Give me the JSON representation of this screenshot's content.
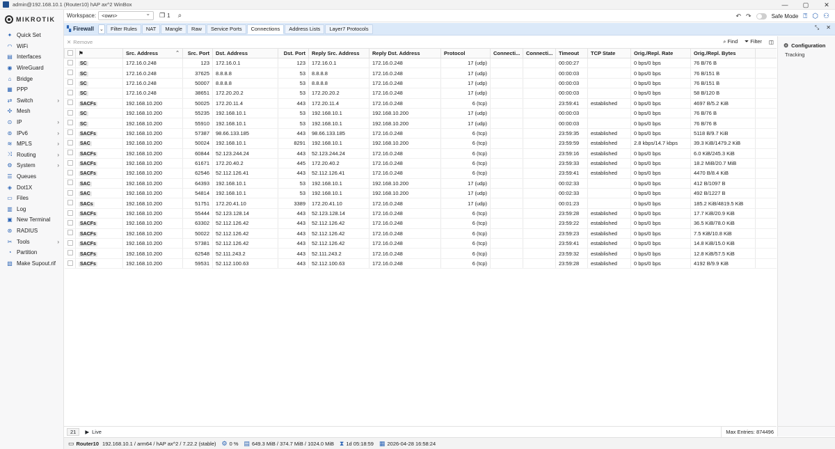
{
  "window": {
    "title": "admin@192.168.10.1 (Router10) hAP ax^2 WinBox",
    "controls": [
      "—",
      "▢",
      "✕"
    ]
  },
  "brand": {
    "logo_text": "MIKROTIK"
  },
  "sidebar": {
    "items": [
      {
        "label": "Quick Set",
        "icon": "magic-wand-icon",
        "glyph": "✦",
        "chevron": ""
      },
      {
        "label": "WiFi",
        "icon": "wifi-icon",
        "glyph": "◠",
        "chevron": ""
      },
      {
        "label": "Interfaces",
        "icon": "interfaces-icon",
        "glyph": "▤",
        "chevron": ""
      },
      {
        "label": "WireGuard",
        "icon": "wireguard-icon",
        "glyph": "◉",
        "chevron": ""
      },
      {
        "label": "Bridge",
        "icon": "bridge-icon",
        "glyph": "⌂",
        "chevron": ""
      },
      {
        "label": "PPP",
        "icon": "ppp-icon",
        "glyph": "▦",
        "chevron": ""
      },
      {
        "label": "Switch",
        "icon": "switch-icon",
        "glyph": "⇄",
        "chevron": "›"
      },
      {
        "label": "Mesh",
        "icon": "mesh-icon",
        "glyph": "✣",
        "chevron": ""
      },
      {
        "label": "IP",
        "icon": "ip-icon",
        "glyph": "⊙",
        "chevron": "›"
      },
      {
        "label": "IPv6",
        "icon": "ipv6-icon",
        "glyph": "⊚",
        "chevron": "›"
      },
      {
        "label": "MPLS",
        "icon": "mpls-icon",
        "glyph": "≋",
        "chevron": "›"
      },
      {
        "label": "Routing",
        "icon": "routing-icon",
        "glyph": "⤨",
        "chevron": "›"
      },
      {
        "label": "System",
        "icon": "system-icon",
        "glyph": "⚙",
        "chevron": "›"
      },
      {
        "label": "Queues",
        "icon": "queues-icon",
        "glyph": "☰",
        "chevron": ""
      },
      {
        "label": "Dot1X",
        "icon": "dot1x-icon",
        "glyph": "◈",
        "chevron": ""
      },
      {
        "label": "Files",
        "icon": "files-icon",
        "glyph": "▭",
        "chevron": ""
      },
      {
        "label": "Log",
        "icon": "log-icon",
        "glyph": "▥",
        "chevron": ""
      },
      {
        "label": "New Terminal",
        "icon": "terminal-icon",
        "glyph": "▣",
        "chevron": ""
      },
      {
        "label": "RADIUS",
        "icon": "radius-icon",
        "glyph": "⊛",
        "chevron": ""
      },
      {
        "label": "Tools",
        "icon": "tools-icon",
        "glyph": "✂",
        "chevron": "›"
      },
      {
        "label": "Partition",
        "icon": "partition-icon",
        "glyph": "◔",
        "chevron": ""
      },
      {
        "label": "Make Supout.rif",
        "icon": "supout-icon",
        "glyph": "▧",
        "chevron": ""
      }
    ]
  },
  "toolbar": {
    "workspace_label": "Workspace:",
    "workspace_value": "<own>",
    "window_count": "1",
    "safe_mode_label": "Safe Mode"
  },
  "tabs": {
    "main_label": "Firewall",
    "items": [
      {
        "label": "Filter Rules",
        "active": false
      },
      {
        "label": "NAT",
        "active": false
      },
      {
        "label": "Mangle",
        "active": false
      },
      {
        "label": "Raw",
        "active": false
      },
      {
        "label": "Service Ports",
        "active": false
      },
      {
        "label": "Connections",
        "active": true
      },
      {
        "label": "Address Lists",
        "active": false
      },
      {
        "label": "Layer7 Protocols",
        "active": false
      }
    ]
  },
  "actions": {
    "remove": "Remove",
    "find": "Find",
    "filter": "Filter"
  },
  "table": {
    "columns": [
      "Src. Address",
      "Src. Port",
      "Dst. Address",
      "Dst. Port",
      "Reply Src. Address",
      "Reply Dst. Address",
      "Protocol",
      "Connecti...",
      "Connecti...",
      "Timeout",
      "TCP State",
      "Orig./Repl. Rate",
      "Orig./Repl. Bytes"
    ],
    "rows": [
      [
        "SC",
        "172.16.0.248",
        "123",
        "172.16.0.1",
        "123",
        "172.16.0.1",
        "172.16.0.248",
        "17 (udp)",
        "",
        "",
        "00:00:27",
        "",
        "0 bps/0 bps",
        "76 B/76 B"
      ],
      [
        "SC",
        "172.16.0.248",
        "37625",
        "8.8.8.8",
        "53",
        "8.8.8.8",
        "172.16.0.248",
        "17 (udp)",
        "",
        "",
        "00:00:03",
        "",
        "0 bps/0 bps",
        "76 B/151 B"
      ],
      [
        "SC",
        "172.16.0.248",
        "50007",
        "8.8.8.8",
        "53",
        "8.8.8.8",
        "172.16.0.248",
        "17 (udp)",
        "",
        "",
        "00:00:03",
        "",
        "0 bps/0 bps",
        "76 B/151 B"
      ],
      [
        "SC",
        "172.16.0.248",
        "38651",
        "172.20.20.2",
        "53",
        "172.20.20.2",
        "172.16.0.248",
        "17 (udp)",
        "",
        "",
        "00:00:03",
        "",
        "0 bps/0 bps",
        "58 B/120 B"
      ],
      [
        "SACFs",
        "192.168.10.200",
        "50025",
        "172.20.11.4",
        "443",
        "172.20.11.4",
        "172.16.0.248",
        "6 (tcp)",
        "",
        "",
        "23:59:41",
        "established",
        "0 bps/0 bps",
        "4697 B/5.2 KiB"
      ],
      [
        "SC",
        "192.168.10.200",
        "55235",
        "192.168.10.1",
        "53",
        "192.168.10.1",
        "192.168.10.200",
        "17 (udp)",
        "",
        "",
        "00:00:03",
        "",
        "0 bps/0 bps",
        "76 B/76 B"
      ],
      [
        "SC",
        "192.168.10.200",
        "55910",
        "192.168.10.1",
        "53",
        "192.168.10.1",
        "192.168.10.200",
        "17 (udp)",
        "",
        "",
        "00:00:03",
        "",
        "0 bps/0 bps",
        "76 B/76 B"
      ],
      [
        "SACFs",
        "192.168.10.200",
        "57387",
        "98.66.133.185",
        "443",
        "98.66.133.185",
        "172.16.0.248",
        "6 (tcp)",
        "",
        "",
        "23:59:35",
        "established",
        "0 bps/0 bps",
        "5118 B/9.7 KiB"
      ],
      [
        "SAC",
        "192.168.10.200",
        "50024",
        "192.168.10.1",
        "8291",
        "192.168.10.1",
        "192.168.10.200",
        "6 (tcp)",
        "",
        "",
        "23:59:59",
        "established",
        "2.8 kbps/14.7 kbps",
        "39.3 KiB/1479.2 KiB"
      ],
      [
        "SACFs",
        "192.168.10.200",
        "60844",
        "52.123.244.24",
        "443",
        "52.123.244.24",
        "172.16.0.248",
        "6 (tcp)",
        "",
        "",
        "23:59:16",
        "established",
        "0 bps/0 bps",
        "6.0 KiB/245.3 KiB"
      ],
      [
        "SACFs",
        "192.168.10.200",
        "61671",
        "172.20.40.2",
        "445",
        "172.20.40.2",
        "172.16.0.248",
        "6 (tcp)",
        "",
        "",
        "23:59:33",
        "established",
        "0 bps/0 bps",
        "18.2 MiB/20.7 MiB"
      ],
      [
        "SACFs",
        "192.168.10.200",
        "62546",
        "52.112.126.41",
        "443",
        "52.112.126.41",
        "172.16.0.248",
        "6 (tcp)",
        "",
        "",
        "23:59:41",
        "established",
        "0 bps/0 bps",
        "4470 B/8.4 KiB"
      ],
      [
        "SAC",
        "192.168.10.200",
        "64393",
        "192.168.10.1",
        "53",
        "192.168.10.1",
        "192.168.10.200",
        "17 (udp)",
        "",
        "",
        "00:02:33",
        "",
        "0 bps/0 bps",
        "412 B/1097 B"
      ],
      [
        "SAC",
        "192.168.10.200",
        "54814",
        "192.168.10.1",
        "53",
        "192.168.10.1",
        "192.168.10.200",
        "17 (udp)",
        "",
        "",
        "00:02:33",
        "",
        "0 bps/0 bps",
        "492 B/1227 B"
      ],
      [
        "SACs",
        "192.168.10.200",
        "51751",
        "172.20.41.10",
        "3389",
        "172.20.41.10",
        "172.16.0.248",
        "17 (udp)",
        "",
        "",
        "00:01:23",
        "",
        "0 bps/0 bps",
        "185.2 KiB/4819.5 KiB"
      ],
      [
        "SACFs",
        "192.168.10.200",
        "55444",
        "52.123.128.14",
        "443",
        "52.123.128.14",
        "172.16.0.248",
        "6 (tcp)",
        "",
        "",
        "23:59:28",
        "established",
        "0 bps/0 bps",
        "17.7 KiB/20.9 KiB"
      ],
      [
        "SACFs",
        "192.168.10.200",
        "63302",
        "52.112.126.42",
        "443",
        "52.112.126.42",
        "172.16.0.248",
        "6 (tcp)",
        "",
        "",
        "23:59:22",
        "established",
        "0 bps/0 bps",
        "36.5 KiB/78.0 KiB"
      ],
      [
        "SACFs",
        "192.168.10.200",
        "50022",
        "52.112.126.42",
        "443",
        "52.112.126.42",
        "172.16.0.248",
        "6 (tcp)",
        "",
        "",
        "23:59:23",
        "established",
        "0 bps/0 bps",
        "7.5 KiB/10.8 KiB"
      ],
      [
        "SACFs",
        "192.168.10.200",
        "57381",
        "52.112.126.42",
        "443",
        "52.112.126.42",
        "172.16.0.248",
        "6 (tcp)",
        "",
        "",
        "23:59:41",
        "established",
        "0 bps/0 bps",
        "14.8 KiB/15.0 KiB"
      ],
      [
        "SACFs",
        "192.168.10.200",
        "62548",
        "52.111.243.2",
        "443",
        "52.111.243.2",
        "172.16.0.248",
        "6 (tcp)",
        "",
        "",
        "23:59:32",
        "established",
        "0 bps/0 bps",
        "12.8 KiB/57.5 KiB"
      ],
      [
        "SACFs",
        "192.168.10.200",
        "59531",
        "52.112.100.63",
        "443",
        "52.112.100.63",
        "172.16.0.248",
        "6 (tcp)",
        "",
        "",
        "23:59:28",
        "established",
        "0 bps/0 bps",
        "4192 B/9.9 KiB"
      ]
    ]
  },
  "right_panel": {
    "items": [
      {
        "label": "Configuration",
        "active": true
      },
      {
        "label": "Tracking",
        "active": false
      }
    ]
  },
  "footer": {
    "count": "21",
    "live_label": "Live",
    "max_entries": "Max Entries: 874496"
  },
  "status": {
    "hostname": "Router10",
    "device": "192.168.10.1 / arm64 / hAP ax^2 / 7.22.2 (stable)",
    "cpu": "0 %",
    "memory": "649.3 MiB / 374.7 MiB / 1024.0 MiB",
    "uptime": "1d 05:18:59",
    "datetime": "2026-04-28 16:58:24"
  },
  "colors": {
    "accent": "#2b64b5",
    "tabbar": "#dbe9f9",
    "sidebar": "#f7f7f8"
  }
}
